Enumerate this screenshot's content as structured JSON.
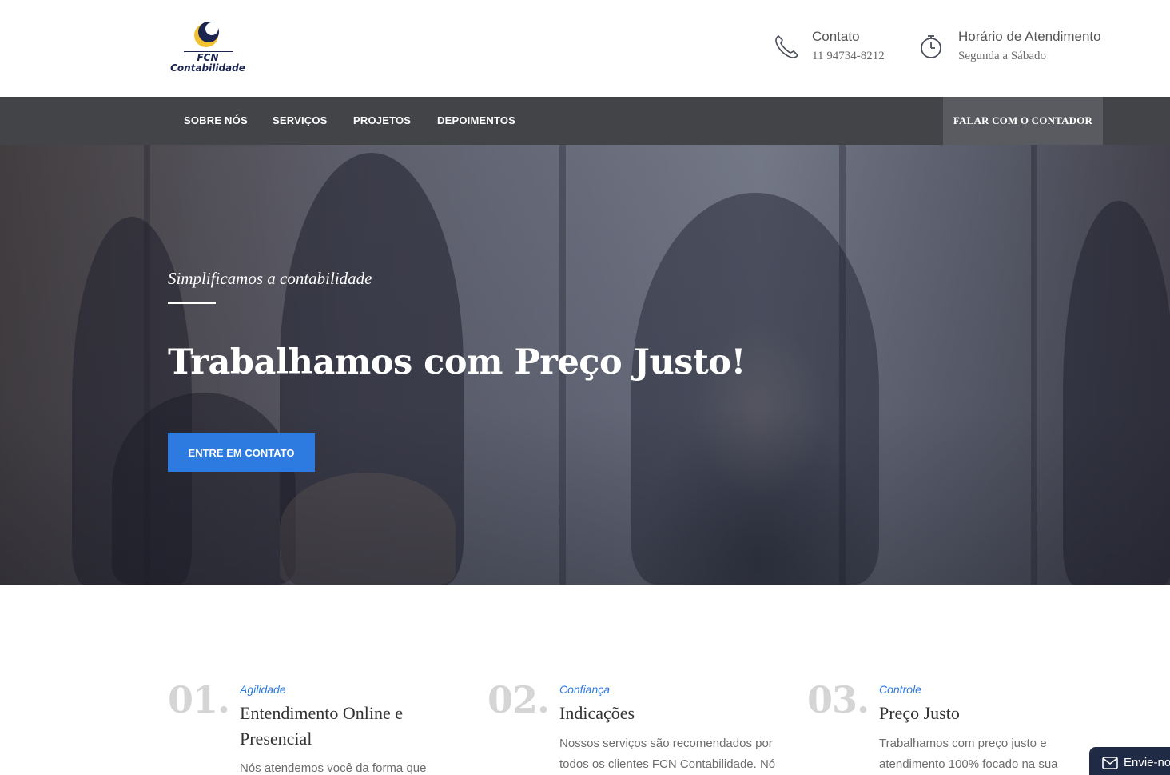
{
  "header": {
    "logo": {
      "line1": "FCN",
      "line2": "Contabilidade"
    },
    "contact": {
      "title": "Contato",
      "value": "11 94734-8212"
    },
    "hours": {
      "title": "Horário de Atendimento",
      "value": "Segunda a Sábado"
    }
  },
  "nav": {
    "items": [
      "SOBRE NÓS",
      "SERVIÇOS",
      "PROJETOS",
      "DEPOIMENTOS"
    ],
    "cta_label": "FALAR COM O CONTADOR"
  },
  "hero": {
    "tagline": "Simplificamos a contabilidade",
    "headline": "Trabalhamos com Preço Justo!",
    "button_label": "ENTRE EM CONTATO"
  },
  "features": [
    {
      "number": "01.",
      "category": "Agilidade",
      "title": "Entendimento Online e Presencial",
      "text": "Nós atendemos você da forma que"
    },
    {
      "number": "02.",
      "category": "Confiança",
      "title": "Indicações",
      "text": "Nossos serviços são recomendados por todos os clientes FCN Contabilidade. Nós"
    },
    {
      "number": "03.",
      "category": "Controle",
      "title": "Preço Justo",
      "text": "Trabalhamos com preço justo e atendimento 100% focado na sua"
    }
  ],
  "chat": {
    "label": "Envie-no"
  },
  "colors": {
    "accent": "#2d7be0",
    "nav_bg": "#434448",
    "cta_bg": "#5a5b60",
    "logo_navy": "#1c2450",
    "logo_gold": "#f2c230"
  },
  "icons": {
    "contact": "phone-icon",
    "hours": "stopwatch-icon",
    "chat": "envelope-icon"
  }
}
